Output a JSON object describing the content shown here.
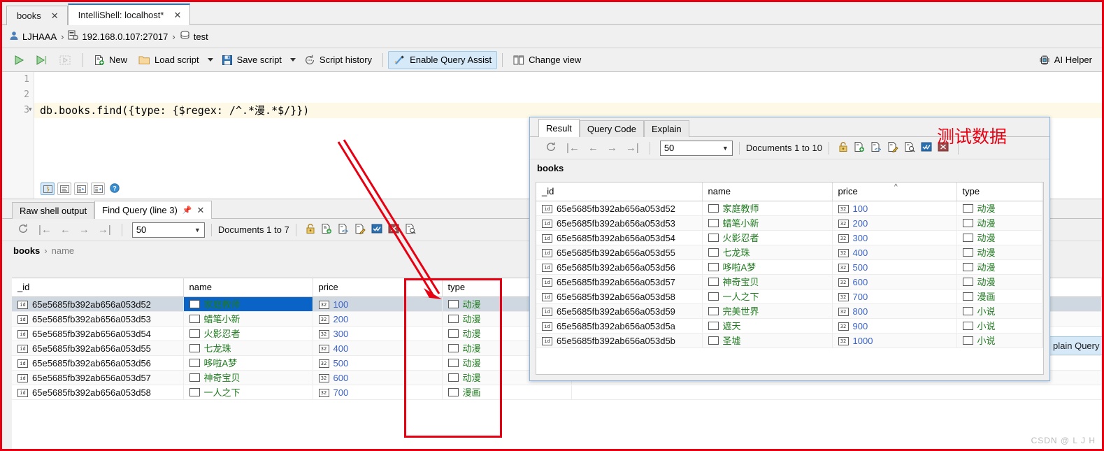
{
  "window": {
    "tabs": [
      {
        "label": "books",
        "active": false,
        "close": "✕"
      },
      {
        "label": "IntelliShell: localhost*",
        "active": true,
        "close": "✕"
      }
    ]
  },
  "breadcrumb": {
    "user": "LJHAAA",
    "sep": "›",
    "server": "192.168.0.107:27017",
    "database": "test"
  },
  "toolbar": {
    "run_label": "▷",
    "run_to_label": "▷|",
    "run_step_label": "▷",
    "new_label": "New",
    "load_script_label": "Load script",
    "save_script_label": "Save script",
    "script_history_label": "Script history",
    "query_assist_label": "Enable Query Assist",
    "change_view_label": "Change view",
    "ai_helper_label": "AI Helper"
  },
  "editor": {
    "line_numbers": [
      "1",
      "2",
      "3"
    ],
    "lines": [
      "",
      "",
      "db.books.find({type: {$regex: /^.*漫.*$/}})"
    ],
    "current_line_index": 3
  },
  "result_window": {
    "tabs": [
      {
        "label": "Result",
        "active": true
      },
      {
        "label": "Query Code",
        "active": false
      },
      {
        "label": "Explain",
        "active": false
      }
    ],
    "page_size": "50",
    "documents_info": "Documents 1 to 10",
    "collection_title": "books",
    "columns": [
      "_id",
      "name",
      "price",
      "type"
    ],
    "rows": [
      {
        "_id": "65e5685fb392ab656a053d52",
        "name": "家庭教师",
        "price": "100",
        "type": "动漫"
      },
      {
        "_id": "65e5685fb392ab656a053d53",
        "name": "蜡笔小新",
        "price": "200",
        "type": "动漫"
      },
      {
        "_id": "65e5685fb392ab656a053d54",
        "name": "火影忍者",
        "price": "300",
        "type": "动漫"
      },
      {
        "_id": "65e5685fb392ab656a053d55",
        "name": "七龙珠",
        "price": "400",
        "type": "动漫"
      },
      {
        "_id": "65e5685fb392ab656a053d56",
        "name": "哆啦A梦",
        "price": "500",
        "type": "动漫"
      },
      {
        "_id": "65e5685fb392ab656a053d57",
        "name": "神奇宝贝",
        "price": "600",
        "type": "动漫"
      },
      {
        "_id": "65e5685fb392ab656a053d58",
        "name": "一人之下",
        "price": "700",
        "type": "漫画"
      },
      {
        "_id": "65e5685fb392ab656a053d59",
        "name": "完美世界",
        "price": "800",
        "type": "小说"
      },
      {
        "_id": "65e5685fb392ab656a053d5a",
        "name": "遮天",
        "price": "900",
        "type": "小说"
      },
      {
        "_id": "65e5685fb392ab656a053d5b",
        "name": "圣墟",
        "price": "1000",
        "type": "小说"
      }
    ]
  },
  "bottom_panel": {
    "tabs": [
      {
        "label": "Raw shell output",
        "active": false
      },
      {
        "label": "Find Query (line 3)",
        "active": true,
        "pin": "📌",
        "close": "✕"
      }
    ],
    "page_size": "50",
    "documents_info": "Documents 1 to 7",
    "breadcrumb_collection": "books",
    "breadcrumb_field": "name",
    "columns": [
      "_id",
      "name",
      "price",
      "type"
    ],
    "rows": [
      {
        "_id": "65e5685fb392ab656a053d52",
        "name": "家庭教师",
        "price": "100",
        "type": "动漫",
        "selected": true
      },
      {
        "_id": "65e5685fb392ab656a053d53",
        "name": "蜡笔小新",
        "price": "200",
        "type": "动漫",
        "selected": false
      },
      {
        "_id": "65e5685fb392ab656a053d54",
        "name": "火影忍者",
        "price": "300",
        "type": "动漫",
        "selected": false
      },
      {
        "_id": "65e5685fb392ab656a053d55",
        "name": "七龙珠",
        "price": "400",
        "type": "动漫",
        "selected": false
      },
      {
        "_id": "65e5685fb392ab656a053d56",
        "name": "哆啦A梦",
        "price": "500",
        "type": "动漫",
        "selected": false
      },
      {
        "_id": "65e5685fb392ab656a053d57",
        "name": "神奇宝贝",
        "price": "600",
        "type": "动漫",
        "selected": false
      },
      {
        "_id": "65e5685fb392ab656a053d58",
        "name": "一人之下",
        "price": "700",
        "type": "漫画",
        "selected": false
      }
    ],
    "plain_query_label": "plain Query"
  },
  "annotations": {
    "test_data_label": "测试数据",
    "red_color": "#e60012"
  },
  "watermark": "CSDN @ L J H"
}
